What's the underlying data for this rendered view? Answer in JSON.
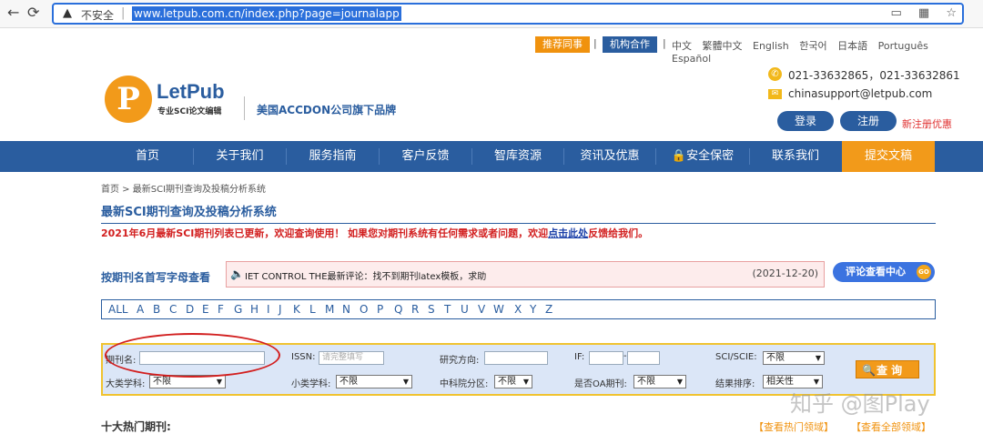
{
  "browser": {
    "insecure": "不安全",
    "url": "www.letpub.com.cn/index.php?page=journalapp"
  },
  "topbar": {
    "recommend": "推荐同事",
    "institution": "机构合作",
    "pipe": "|",
    "languages": [
      "中文",
      "繁體中文",
      "English",
      "한국어",
      "日本語",
      "Português",
      "Español"
    ]
  },
  "brand": {
    "logo_letter": "P",
    "name": "LetPub",
    "subtitle": "专业SCI论文编辑",
    "tagline": "美国ACCDON公司旗下品牌",
    "phone": "021-33632865，021-33632861",
    "email": "chinasupport@letpub.com",
    "login": "登录",
    "register": "注册",
    "register_promo": "新注册优惠"
  },
  "nav": {
    "items": [
      "首页",
      "关于我们",
      "服务指南",
      "客户反馈",
      "智库资源",
      "资讯及优惠",
      "安全保密",
      "联系我们"
    ],
    "submit": "提交文稿"
  },
  "breadcrumb": "首页 > 最新SCI期刊查询及投稿分析系统",
  "page_title": "最新SCI期刊查询及投稿分析系统",
  "notice": {
    "text1": "2021年6月最新SCI期刊列表已更新，欢迎查询使用！ 如果您对期刊系统有任何需求或者问题，欢迎",
    "link": "点击此处",
    "text2": "反馈给我们。"
  },
  "alpha_label": "按期刊名首写字母查看",
  "ticker": {
    "text": "IET CONTROL THE最新评论：找不到期刊latex模板，求助",
    "date": "(2021-12-20)"
  },
  "review_button": "评论查看中心",
  "review_go": "GO",
  "alphabet": [
    "ALL",
    "A",
    "B",
    "C",
    "D",
    "E",
    "F",
    "G",
    "H",
    "I",
    "J",
    "K",
    "L",
    "M",
    "N",
    "O",
    "P",
    "Q",
    "R",
    "S",
    "T",
    "U",
    "V",
    "W",
    "X",
    "Y",
    "Z"
  ],
  "search": {
    "journal_label": "期刊名:",
    "issn_label": "ISSN:",
    "issn_placeholder": "请完整填写",
    "field_label": "研究方向:",
    "if_label": "IF:",
    "if_dash": "-",
    "sci_label": "SCI/SCIE:",
    "sci_value": "不限",
    "major_label": "大类学科:",
    "major_value": "不限",
    "minor_label": "小类学科:",
    "minor_value": "不限",
    "cas_label": "中科院分区:",
    "cas_value": "不限",
    "oa_label": "是否OA期刊:",
    "oa_value": "不限",
    "sort_label": "结果排序:",
    "sort_value": "相关性",
    "button": "查 询"
  },
  "hot": {
    "title": "十大热门期刊:",
    "link1": "【查看热门领域】",
    "link2": "【查看全部领域】"
  },
  "watermark": "知乎 @图Play"
}
